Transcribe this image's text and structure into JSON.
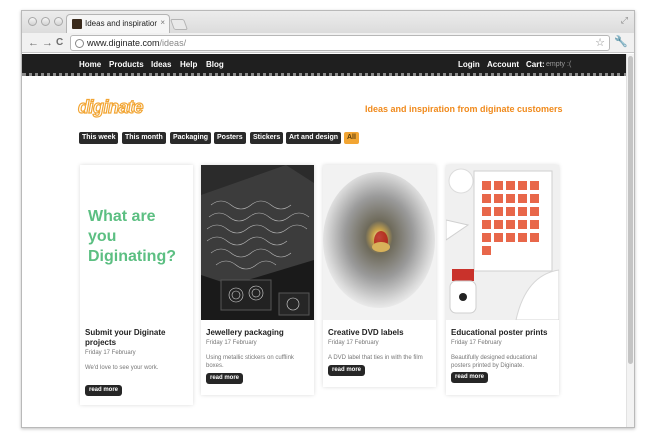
{
  "browser": {
    "tab_title": "Ideas and inspiration - digin",
    "tab_close": "×",
    "url_host": "www.diginate.com",
    "url_path": "/ideas/",
    "back": "←",
    "forward": "→",
    "reload": "C",
    "star": "☆",
    "wrench": "🔧",
    "resize": "⤢"
  },
  "sitenav": {
    "left": [
      "Home",
      "Products",
      "Ideas",
      "Help",
      "Blog"
    ],
    "login": "Login",
    "account": "Account",
    "cart": "Cart:",
    "cart_status": "empty :("
  },
  "header": {
    "logo": "diginate",
    "tagline": "Ideas and inspiration from diginate customers"
  },
  "filters": [
    "This week",
    "This month",
    "Packaging",
    "Posters",
    "Stickers",
    "Art and design",
    "All"
  ],
  "filter_active": "All",
  "cards": [
    {
      "title": "Submit your Diginate projects",
      "date": "Friday 17 February",
      "description": "We'd love to see your work.",
      "image_text": "What are you Diginating?",
      "button": "read more"
    },
    {
      "title": "Jewellery packaging",
      "date": "Friday 17 February",
      "description": "Using metallic stickers on cufflink boxes.",
      "button": "read more"
    },
    {
      "title": "Creative DVD labels",
      "date": "Friday 17 February",
      "description": "A DVD label that ties in with the film",
      "button": "read more"
    },
    {
      "title": "Educational poster prints",
      "date": "Friday 17 February",
      "description": "Beautifully designed educational posters printed by Diginate.",
      "button": "read more"
    }
  ],
  "colors": {
    "accent": "#f2a533",
    "green": "#5cbf82",
    "nav_bg": "#1f1f1f"
  }
}
